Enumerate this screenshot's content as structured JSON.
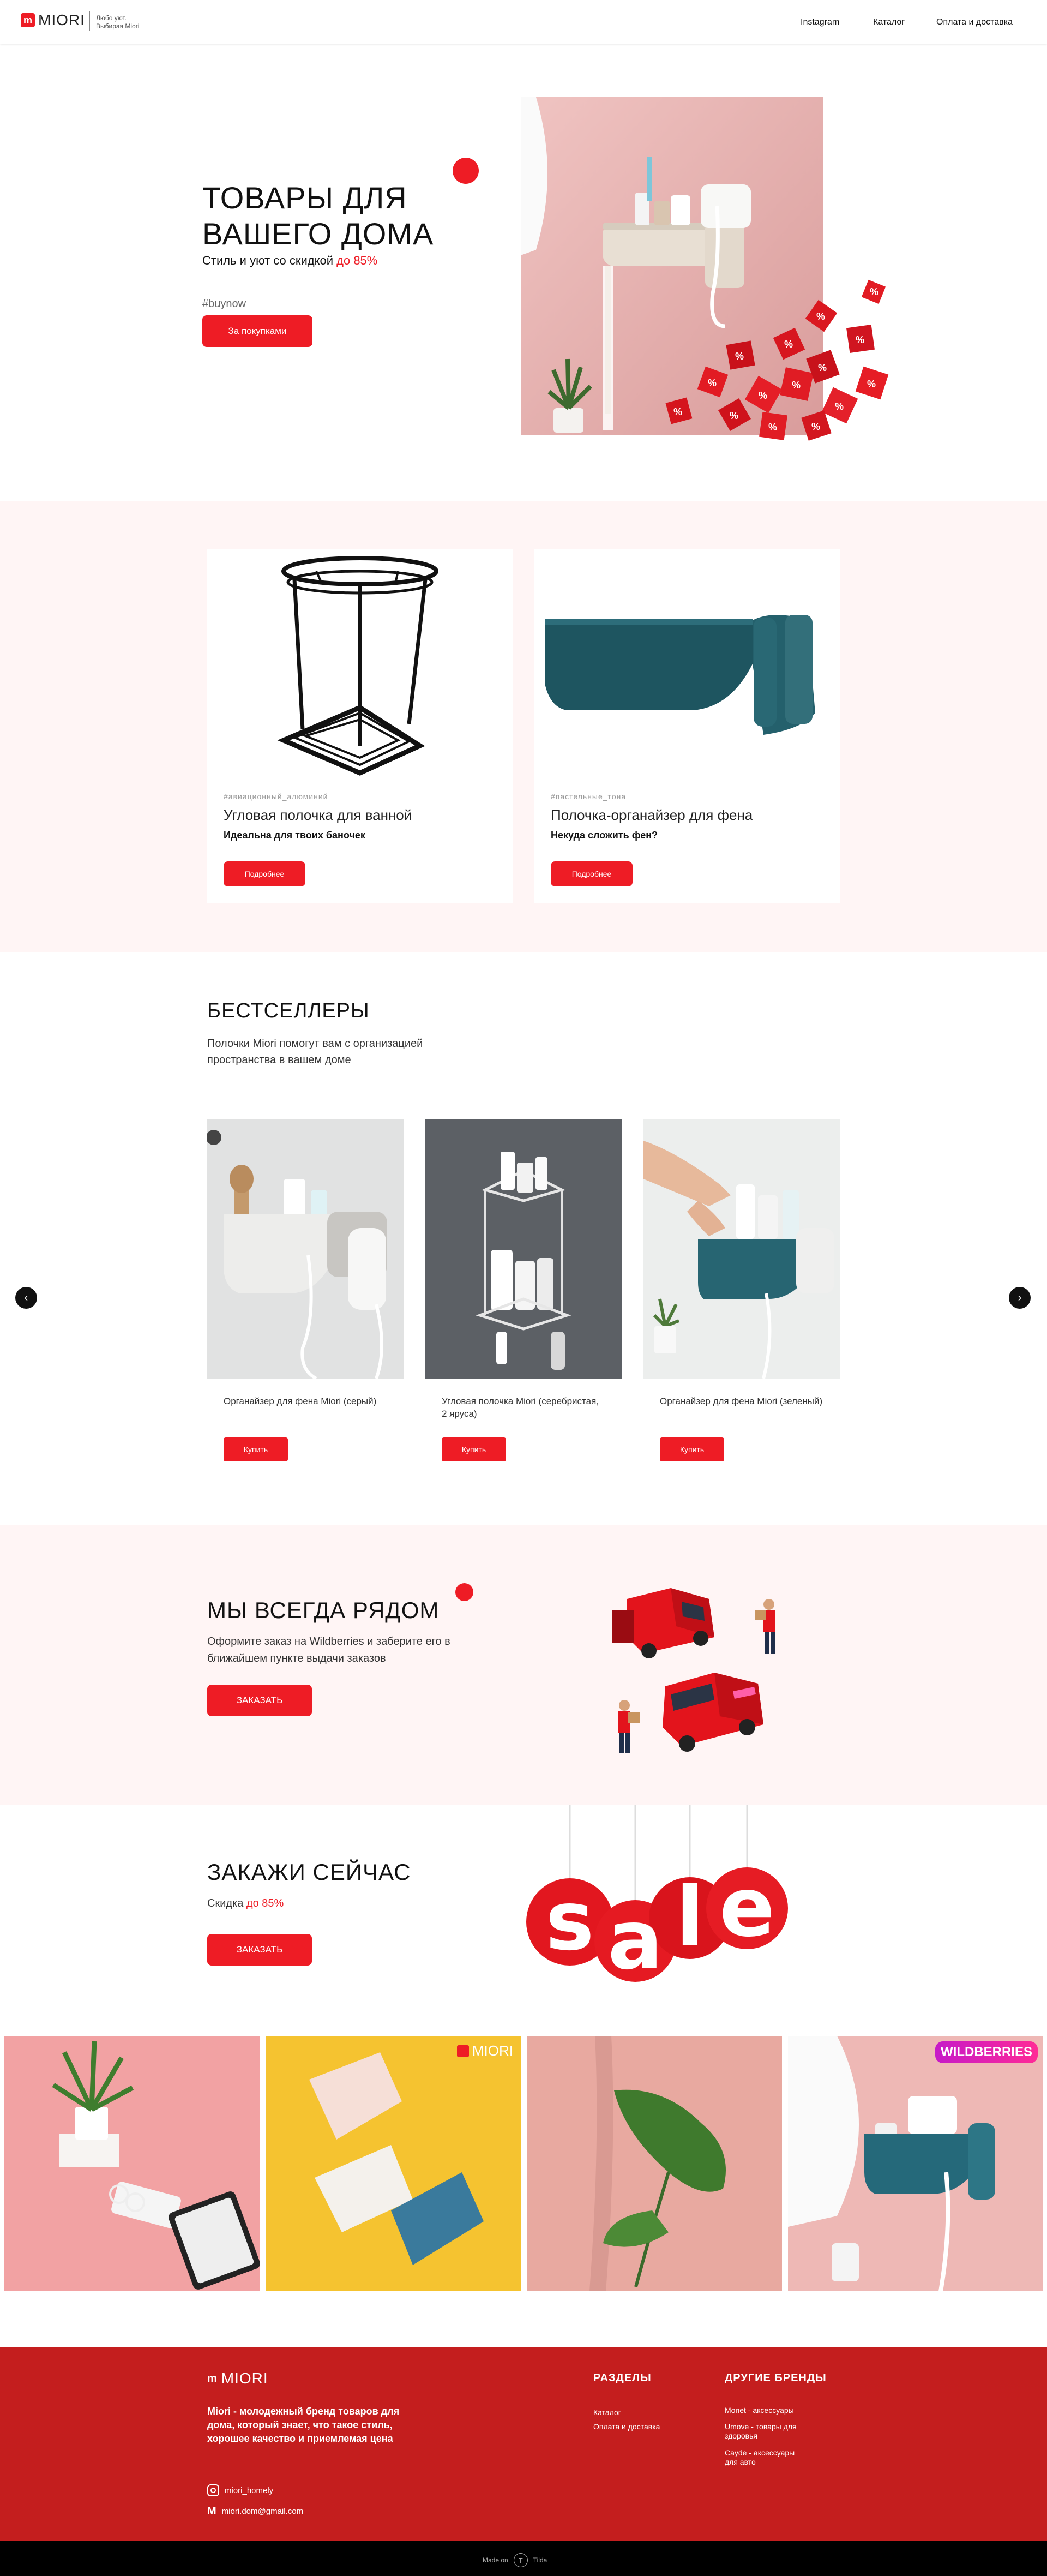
{
  "header": {
    "logo_mark": "m",
    "logo_text": "MIORI",
    "tagline_1": "Любо уют.",
    "tagline_2": "Выбирая Miori",
    "nav": [
      "Instagram",
      "Каталог",
      "Оплата и доставка"
    ]
  },
  "hero": {
    "title_1": "ТОВАРЫ ДЛЯ",
    "title_2": "ВАШЕГО ДОМА",
    "subtitle": "Стиль и уют со скидкой",
    "subtitle_highlight": "до 85%",
    "hashtag": "#buynow",
    "button": "За покупками"
  },
  "promo": [
    {
      "tag": "#авиационный_алюминий",
      "title": "Угловая полочка для ванной",
      "desc": "Идеальна для твоих баночек",
      "button": "Подробнее"
    },
    {
      "tag": "#пастельные_тона",
      "title": "Полочка-органайзер для фена",
      "desc": "Некуда сложить фен?",
      "button": "Подробнее"
    }
  ],
  "bestsellers": {
    "title": "БЕСТСЕЛЛЕРЫ",
    "desc": "Полочки Miori помогут вам с организацией пространства в вашем доме",
    "products": [
      {
        "name": "Органайзер для фена Miori (серый)",
        "button": "Купить"
      },
      {
        "name": "Угловая полочка Miori (серебристая, 2 яруса)",
        "button": "Купить"
      },
      {
        "name": "Органайзер для фена Miori (зеленый)",
        "button": "Купить"
      }
    ],
    "prev": "‹",
    "next": "›"
  },
  "delivery": {
    "title": "МЫ ВСЕГДА РЯДОМ",
    "desc": "Оформите заказ на Wildberries и заберите его в ближайшем пункте выдачи заказов",
    "button": "ЗАКАЗАТЬ"
  },
  "order": {
    "title": "ЗАКАЖИ СЕЙЧАС",
    "desc": "Скидка",
    "desc_highlight": "до 85%",
    "button": "ЗАКАЗАТЬ",
    "sale_letters": [
      "s",
      "a",
      "l",
      "e"
    ]
  },
  "gallery": {
    "miori_badge": "MIORI",
    "wb_badge": "WILDBERRIES"
  },
  "footer": {
    "logo_text": "MIORI",
    "about": "Miori - молодежный бренд товаров для дома, который знает, что такое стиль, хорошее качество и приемлемая цена",
    "instagram": "miori_homely",
    "email": "miori.dom@gmail.com",
    "sections_title": "РАЗДЕЛЫ",
    "sections": [
      "Каталог",
      "Оплата и доставка"
    ],
    "brands_title": "ДРУГИЕ БРЕНДЫ",
    "brands": [
      "Monet - аксессуары",
      "Umove - товары для здоровья",
      "Cayde - аксессуары для авто"
    ]
  },
  "made_on": {
    "prefix": "Made on",
    "brand": "Tilda"
  },
  "colors": {
    "accent": "#ee1c25",
    "footer": "#c41e1e",
    "section_bg": "#fff5f5"
  }
}
